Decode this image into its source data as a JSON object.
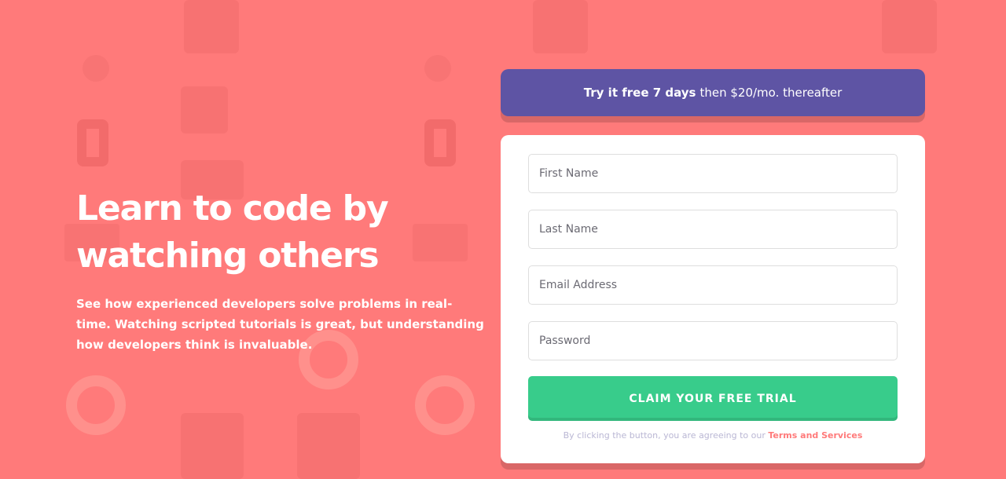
{
  "hero": {
    "title": "Learn to code by watching others",
    "text": "See how experienced developers solve problems in real-time. Watching scripted tutorials is great, but understanding how developers think is invaluable."
  },
  "banner": {
    "bold": "Try it free 7 days",
    "rest": "then $20/mo. thereafter"
  },
  "form": {
    "first_name_placeholder": "First Name",
    "last_name_placeholder": "Last Name",
    "email_placeholder": "Email Address",
    "password_placeholder": "Password",
    "submit_label": "CLAIM YOUR FREE TRIAL",
    "terms_prefix": "By clicking the button, you are agreeing to our",
    "terms_link": "Terms and Services"
  },
  "colors": {
    "background": "#ff7a7a",
    "banner": "#5e54a4",
    "cta": "#38cc8b"
  }
}
